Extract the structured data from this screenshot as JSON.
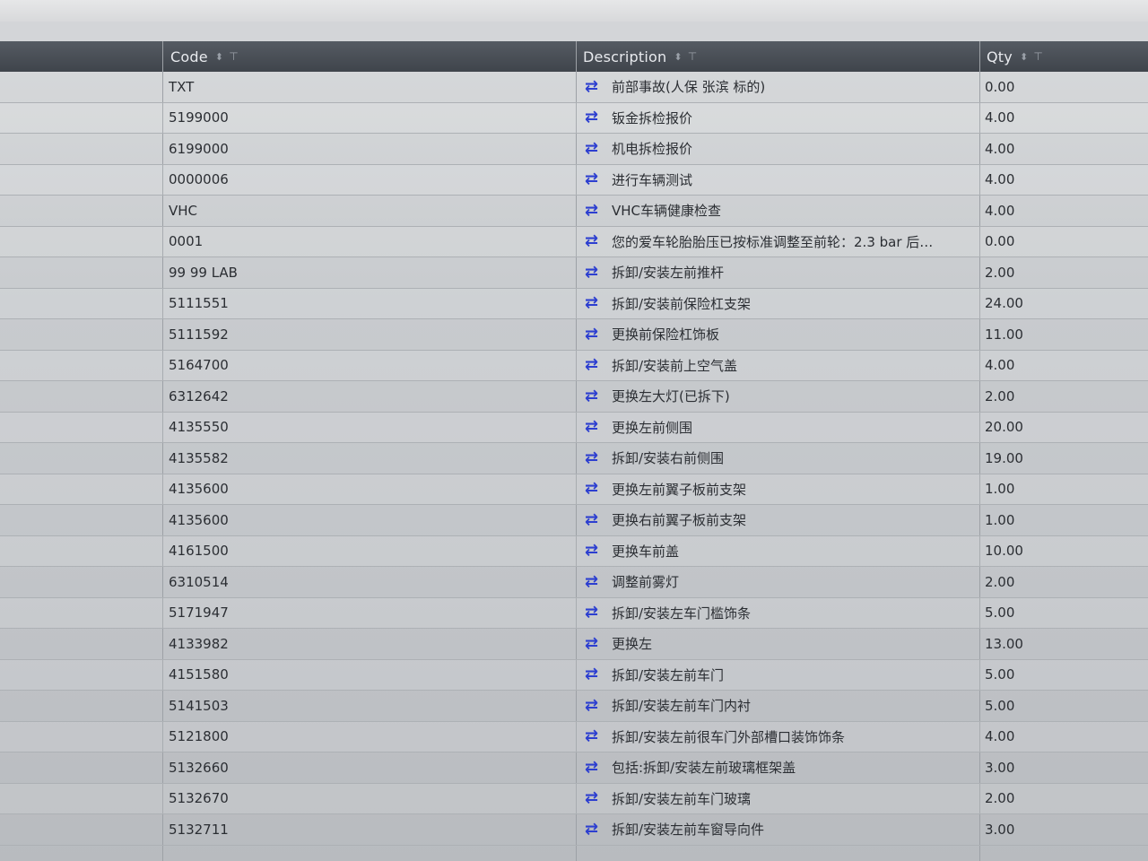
{
  "table": {
    "columns": {
      "code": "Code",
      "description": "Description",
      "qty": "Qty"
    },
    "rows": [
      {
        "code": "TXT",
        "description": "前部事故(人保 张滨 标的)",
        "qty": "0.00"
      },
      {
        "code": "5199000",
        "description": "钣金拆检报价",
        "qty": "4.00"
      },
      {
        "code": "6199000",
        "description": "机电拆检报价",
        "qty": "4.00"
      },
      {
        "code": "0000006",
        "description": "进行车辆测试",
        "qty": "4.00"
      },
      {
        "code": "VHC",
        "description": "VHC车辆健康检查",
        "qty": "4.00"
      },
      {
        "code": "0001",
        "description": "您的爱车轮胎胎压已按标准调整至前轮：2.3 bar 后…",
        "qty": "0.00"
      },
      {
        "code": "99 99 LAB",
        "description": "拆卸/安装左前推杆",
        "qty": "2.00"
      },
      {
        "code": "5111551",
        "description": "拆卸/安装前保险杠支架",
        "qty": "24.00"
      },
      {
        "code": "5111592",
        "description": "更换前保险杠饰板",
        "qty": "11.00"
      },
      {
        "code": "5164700",
        "description": "拆卸/安装前上空气盖",
        "qty": "4.00"
      },
      {
        "code": "6312642",
        "description": "更换左大灯(已拆下)",
        "qty": "2.00"
      },
      {
        "code": "4135550",
        "description": "更换左前侧围",
        "qty": "20.00"
      },
      {
        "code": "4135582",
        "description": "拆卸/安装右前侧围",
        "qty": "19.00"
      },
      {
        "code": "4135600",
        "description": "更换左前翼子板前支架",
        "qty": "1.00"
      },
      {
        "code": "4135600",
        "description": "更换右前翼子板前支架",
        "qty": "1.00"
      },
      {
        "code": "4161500",
        "description": "更换车前盖",
        "qty": "10.00"
      },
      {
        "code": "6310514",
        "description": "调整前雾灯",
        "qty": "2.00"
      },
      {
        "code": "5171947",
        "description": "拆卸/安装左车门槛饰条",
        "qty": "5.00"
      },
      {
        "code": "4133982",
        "description": "更换左",
        "qty": "13.00"
      },
      {
        "code": "4151580",
        "description": "拆卸/安装左前车门",
        "qty": "5.00"
      },
      {
        "code": "5141503",
        "description": "拆卸/安装左前车门内衬",
        "qty": "5.00"
      },
      {
        "code": "5121800",
        "description": "拆卸/安装左前很车门外部槽口装饰饰条",
        "qty": "4.00"
      },
      {
        "code": "5132660",
        "description": "包括:拆卸/安装左前玻璃框架盖",
        "qty": "3.00"
      },
      {
        "code": "5132670",
        "description": "拆卸/安装左前车门玻璃",
        "qty": "2.00"
      },
      {
        "code": "5132711",
        "description": "拆卸/安装左前车窗导向件",
        "qty": "3.00"
      }
    ]
  },
  "icons": {
    "sort": "sort-icon",
    "filter": "filter-icon",
    "swap": "swap-arrows-icon"
  },
  "colors": {
    "header_bg": "#484d55",
    "swap_icon": "#2d3fd0"
  }
}
